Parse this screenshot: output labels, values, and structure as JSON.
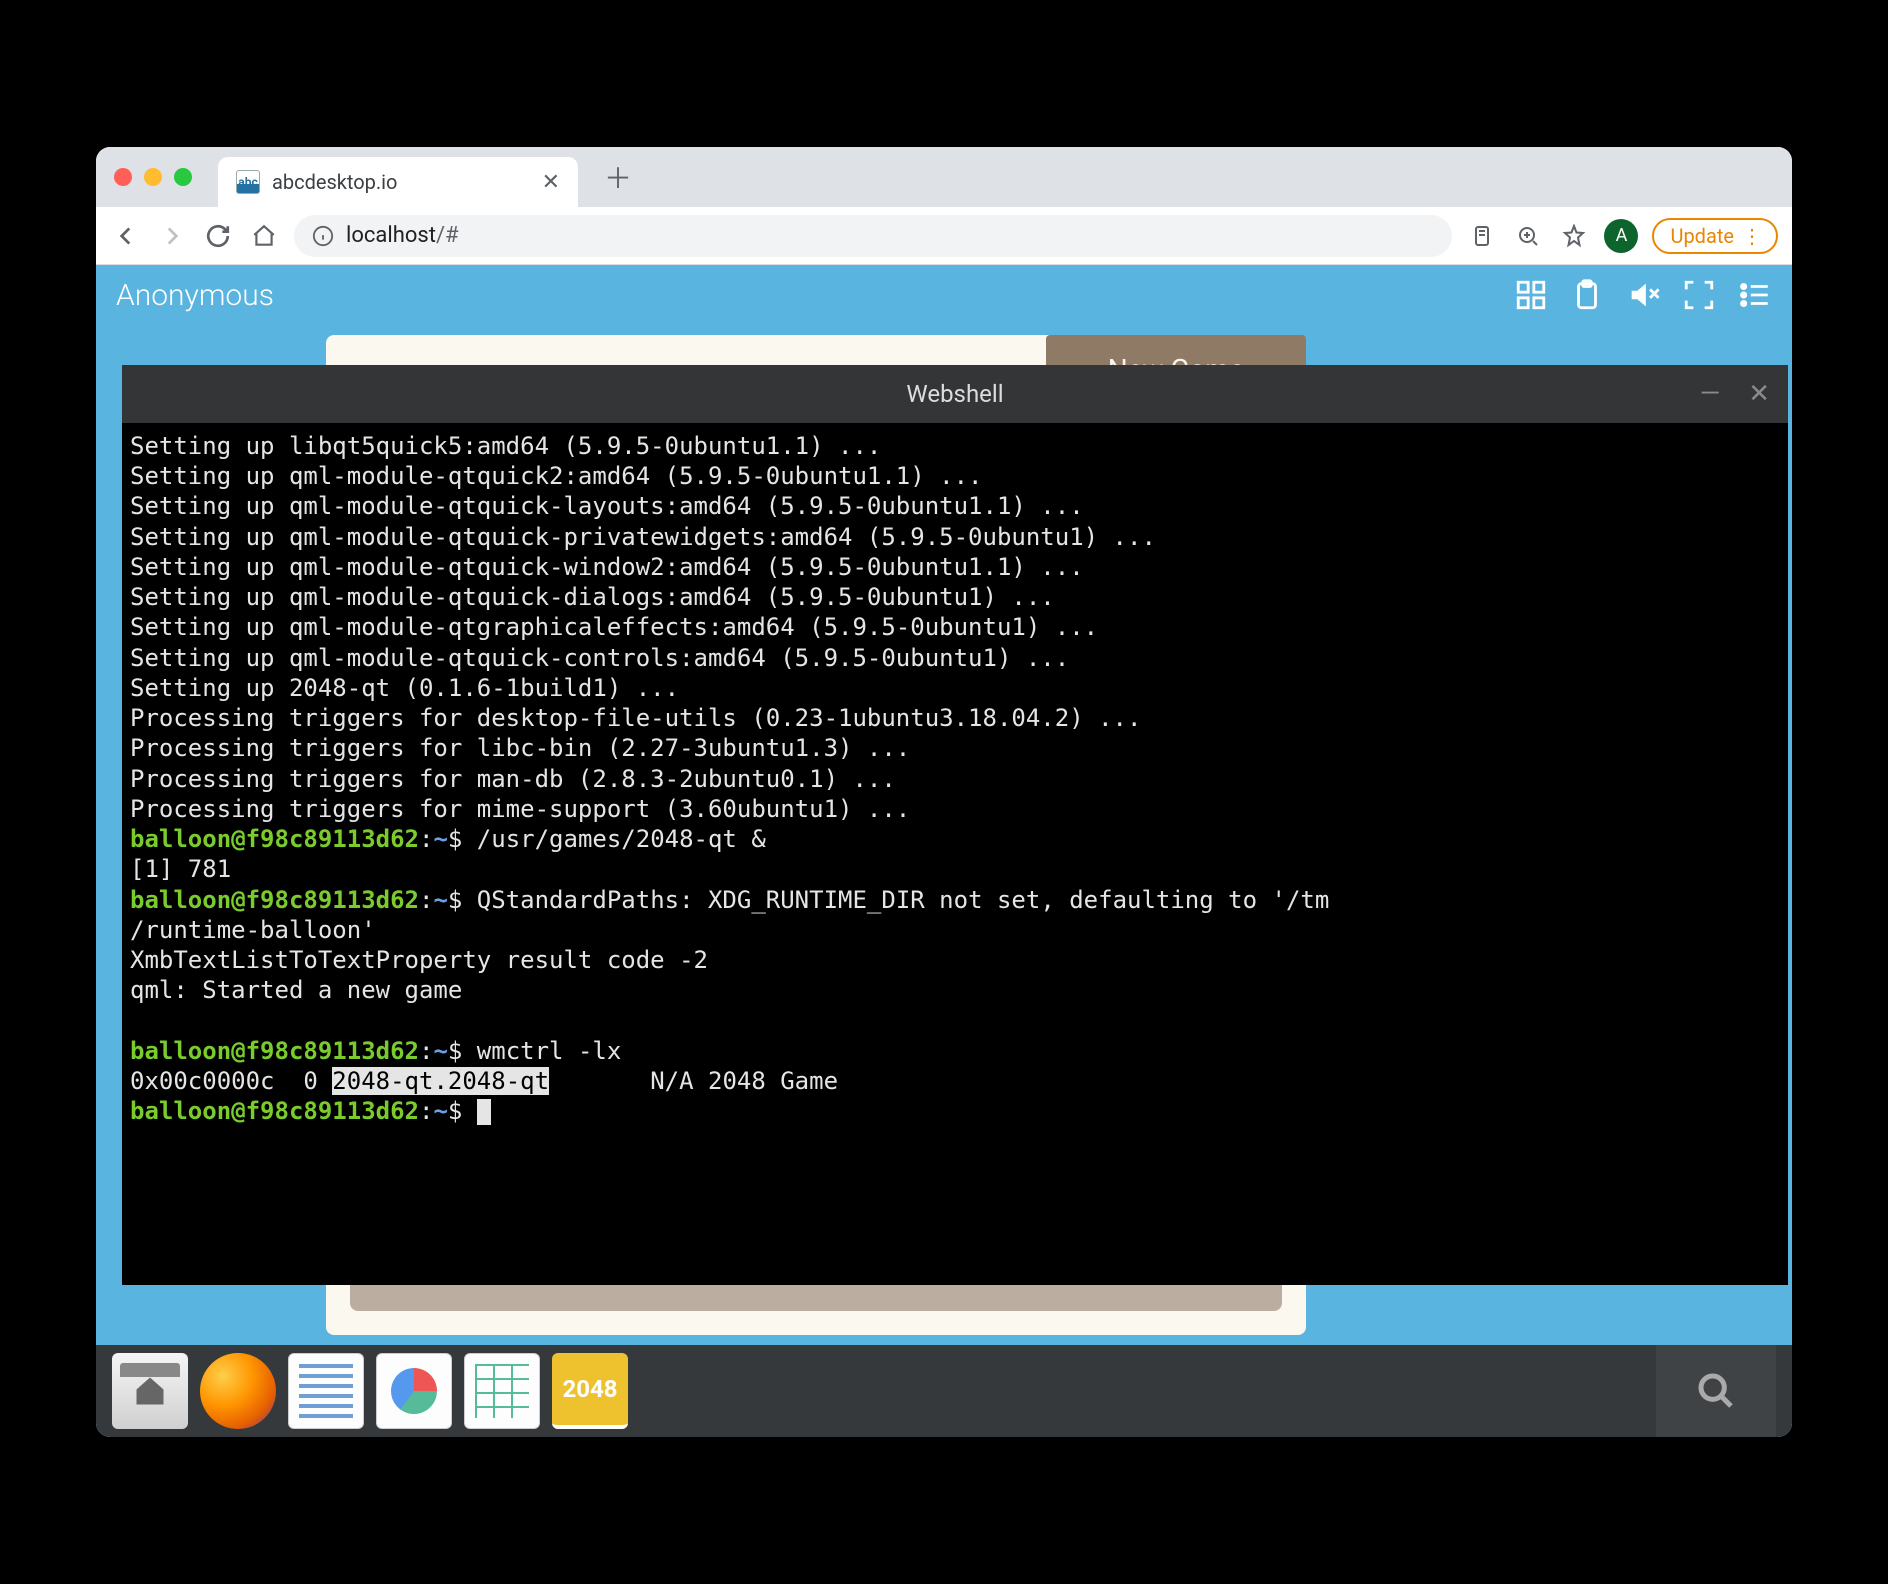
{
  "browser": {
    "tab": {
      "title": "abcdesktop.io",
      "favicon_text": "abc"
    },
    "url_host": "localhost",
    "url_path": "/#",
    "avatar_letter": "A",
    "update_label": "Update"
  },
  "desktop": {
    "username": "Anonymous",
    "game": {
      "new_game_label": "New Game"
    }
  },
  "terminal": {
    "title": "Webshell",
    "prompt_user": "balloon@f98c89113d62",
    "prompt_sep": ":",
    "prompt_path": "~",
    "prompt_char": "$",
    "lines": [
      "Setting up libqt5quick5:amd64 (5.9.5-0ubuntu1.1) ...",
      "Setting up qml-module-qtquick2:amd64 (5.9.5-0ubuntu1.1) ...",
      "Setting up qml-module-qtquick-layouts:amd64 (5.9.5-0ubuntu1.1) ...",
      "Setting up qml-module-qtquick-privatewidgets:amd64 (5.9.5-0ubuntu1) ...",
      "Setting up qml-module-qtquick-window2:amd64 (5.9.5-0ubuntu1.1) ...",
      "Setting up qml-module-qtquick-dialogs:amd64 (5.9.5-0ubuntu1) ...",
      "Setting up qml-module-qtgraphicaleffects:amd64 (5.9.5-0ubuntu1) ...",
      "Setting up qml-module-qtquick-controls:amd64 (5.9.5-0ubuntu1) ...",
      "Setting up 2048-qt (0.1.6-1build1) ...",
      "Processing triggers for desktop-file-utils (0.23-1ubuntu3.18.04.2) ...",
      "Processing triggers for libc-bin (2.27-3ubuntu1.3) ...",
      "Processing triggers for man-db (2.8.3-2ubuntu0.1) ...",
      "Processing triggers for mime-support (3.60ubuntu1) ..."
    ],
    "cmd1": "/usr/games/2048-qt &",
    "out1": "[1] 781",
    "out2a": "QStandardPaths: XDG_RUNTIME_DIR not set, defaulting to '/tm",
    "out2b": "/runtime-balloon'",
    "out3": "XmbTextListToTextProperty result code -2",
    "out4": "qml: Started a new game",
    "cmd2": "wmctrl -lx",
    "wm_pre": "0x00c0000c  0 ",
    "wm_hl": "2048-qt.2048-qt",
    "wm_post": "       N/A 2048 Game"
  },
  "dock": {
    "g2048_label": "2048"
  }
}
